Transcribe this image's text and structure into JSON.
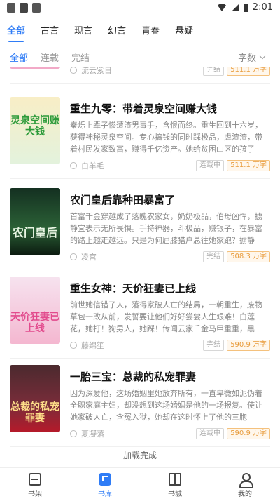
{
  "status_bar": {
    "time": "2:01"
  },
  "category_tabs": [
    "全部",
    "古言",
    "现言",
    "幻言",
    "青春",
    "悬疑"
  ],
  "sub_filters": [
    "全部",
    "连载",
    "完结"
  ],
  "sort_label": "字数",
  "partial_row": {
    "author": "流云紫日",
    "status": "完结",
    "words": "511.1 万字"
  },
  "books": [
    {
      "title": "重生九零：带着灵泉空间赚大钱",
      "desc": "秦烁上辈子惨遭渣男毒手，含恨而终。重生回到十六岁，获得神秘灵泉空间。专心搞钱的同时踩极品，虐渣渣，带着村民发家致富，赚得千亿资产。她给贫困山区的孩子带...",
      "author": "白羊毛",
      "status": "连载中",
      "words": "511.1 万字",
      "cover_text": "灵泉空间赚大钱"
    },
    {
      "title": "农门皇后靠种田暴富了",
      "desc": "首富千金穿越成了落魄农家女，奶奶极品，伯母凶悍，掳静宜表示无所畏惧。手持神器，斗极品，赚银子，在暴富的路上越走越远。只是为何屈膝猎户总往她家跑？掳静宜...",
      "author": "凌宫",
      "status": "完结",
      "words": "508.3 万字",
      "cover_text": "农门皇后"
    },
    {
      "title": "重生女神：天价狂妻已上线",
      "desc": "前世她信错了人，落得家破人亡的结局，一朝重生，废物草包一改从前，发誓要让他们好好尝尝人生艰难！白莲花，她打！狗男人，她踩！传闻云家千金马甲重重，黑粉...",
      "author": "藤绵笙",
      "status": "完结",
      "words": "590.9 万字",
      "cover_text": "天价狂妻已上线"
    },
    {
      "title": "一胎三宝：总裁的私宠罪妻",
      "desc": "因为深爱他，这场婚姻里她放弃所有，一直卑微如泥伪着全职家庭主妇，却没想到这场婚姻是他的一场报复。使让她家破人亡，含冤入狱，她却在这时怀上了他的三胞胎。...",
      "author": "夏凝落",
      "status": "连载中",
      "words": "590.9 万字",
      "cover_text": "总裁的私宠罪妻"
    }
  ],
  "load_done": "加载完成",
  "bottom_nav": [
    "书架",
    "书库",
    "书城",
    "我的"
  ],
  "colors": {
    "accent": "#2f7cf6",
    "words_tag": "#e89b3a"
  }
}
